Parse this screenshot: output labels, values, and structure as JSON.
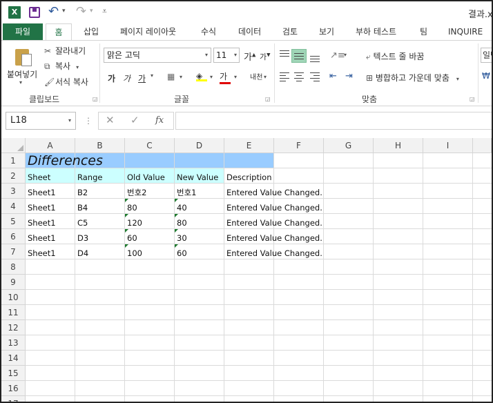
{
  "window": {
    "title": "결과.xl",
    "app_icon": "X"
  },
  "qat": {
    "icons": [
      "excel-icon",
      "save-icon",
      "undo-icon",
      "redo-icon",
      "customize-icon"
    ]
  },
  "tabs": [
    {
      "label": "파일"
    },
    {
      "label": "홈"
    },
    {
      "label": "삽입"
    },
    {
      "label": "페이지 레이아웃"
    },
    {
      "label": "수식"
    },
    {
      "label": "데이터"
    },
    {
      "label": "검토"
    },
    {
      "label": "보기"
    },
    {
      "label": "부하 테스트"
    },
    {
      "label": "팀"
    },
    {
      "label": "INQUIRE"
    }
  ],
  "ribbon": {
    "clipboard": {
      "paste": "붙여넣기",
      "cut": "잘라내기",
      "copy": "복사",
      "format_painter": "서식 복사",
      "group": "클립보드"
    },
    "font": {
      "name": "맑은 고딕",
      "size": "11",
      "grow": "가",
      "shrink": "가",
      "bold": "가",
      "italic": "가",
      "underline": "가",
      "font_color": "가",
      "phonetic": "내천",
      "group": "글꼴"
    },
    "alignment": {
      "wrap_text": "텍스트 줄 바꿈",
      "merge_center": "병합하고 가운데 맞춤",
      "group": "맞춤"
    },
    "number": {
      "format": "일반"
    }
  },
  "formula_bar": {
    "name_box": "L18",
    "cancel": "✕",
    "enter": "✓",
    "fx": "fx",
    "value": ""
  },
  "sheet": {
    "columns": [
      "A",
      "B",
      "C",
      "D",
      "E",
      "F",
      "G",
      "H",
      "I"
    ],
    "rows": [
      "1",
      "2",
      "3",
      "4",
      "5",
      "6",
      "7",
      "8",
      "9",
      "10",
      "11",
      "12",
      "13",
      "14",
      "15",
      "16",
      "17"
    ],
    "title": "Differences",
    "headers": [
      "Sheet",
      "Range",
      "Old Value",
      "New Value",
      "Description"
    ],
    "data": [
      [
        "Sheet1",
        "B2",
        "번호2",
        "번호1",
        "Entered Value Changed."
      ],
      [
        "Sheet1",
        "B4",
        "80",
        "40",
        "Entered Value Changed."
      ],
      [
        "Sheet1",
        "C5",
        "120",
        "80",
        "Entered Value Changed."
      ],
      [
        "Sheet1",
        "D3",
        "60",
        "30",
        "Entered Value Changed."
      ],
      [
        "Sheet1",
        "D4",
        "100",
        "60",
        "Entered Value Changed."
      ]
    ],
    "colors": {
      "title_fill": "#99ccff",
      "header_fill": "#ccffff",
      "error_triangle": "#1e7a2e"
    }
  }
}
